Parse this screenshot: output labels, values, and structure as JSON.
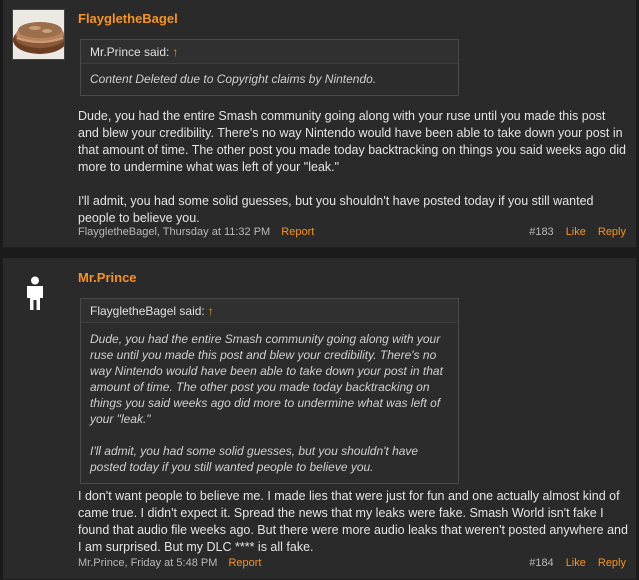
{
  "posts": [
    {
      "username": "FlaygletheBagel",
      "avatar_icon": "bagel-sandwich-icon",
      "quote": {
        "author_said": "Mr.Prince said:",
        "arrow": "↑",
        "paragraphs": [
          "Content Deleted due to Copyright claims by Nintendo."
        ]
      },
      "message": [
        "Dude, you had the entire Smash community going along with your ruse until you made this post and blew your credibility. There's no way Nintendo would have been able to take down your post in that amount of time. The other post you made today backtracking on things you said weeks ago did more to undermine what was left of your \"leak.\"",
        "I'll admit, you had some solid guesses, but you shouldn't have posted today if you still wanted people to believe you."
      ],
      "meta": {
        "author_time": "FlaygletheBagel, Thursday at 11:32 PM",
        "report": "Report",
        "number": "#183",
        "like": "Like",
        "reply": "Reply"
      }
    },
    {
      "username": "Mr.Prince",
      "avatar_icon": "default-person-icon",
      "quote": {
        "author_said": "FlaygletheBagel said:",
        "arrow": "↑",
        "paragraphs": [
          "Dude, you had the entire Smash community going along with your ruse until you made this post and blew your credibility. There's no way Nintendo would have been able to take down your post in that amount of time. The other post you made today backtracking on things you said weeks ago did more to undermine what was left of your \"leak.\"",
          "I'll admit, you had some solid guesses, but you shouldn't have posted today if you still wanted people to believe you."
        ]
      },
      "message": [
        "I don't want people to believe me. I made lies that were just for fun and one actually almost kind of came true. I didn't expect it. Spread the news that my leaks were fake. Smash World isn't fake I found that audio file weeks ago. But there were more audio leaks that weren't posted anywhere and I am surprised. But my DLC **** is all fake."
      ],
      "meta": {
        "author_time": "Mr.Prince, Friday at 5:48 PM",
        "report": "Report",
        "number": "#184",
        "like": "Like",
        "reply": "Reply"
      }
    }
  ],
  "colors": {
    "accent": "#f7941d",
    "post_bg": "#2a2a2a",
    "page_bg": "#1b1b1b",
    "text": "#e4e4e4"
  }
}
